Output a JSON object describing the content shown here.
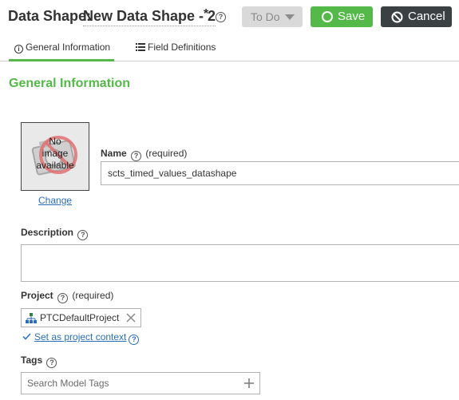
{
  "header": {
    "title_prefix": "Data Shape:",
    "title_name": "New Data Shape - 2",
    "unsaved_marker": "*",
    "help": "?",
    "state_label": "To Do",
    "save_label": "Save",
    "cancel_label": "Cancel"
  },
  "tabs": [
    {
      "label": "General Information",
      "icon": "info-icon",
      "active": true
    },
    {
      "label": "Field Definitions",
      "icon": "list-icon",
      "active": false
    }
  ],
  "section": {
    "title": "General Information"
  },
  "image": {
    "placeholder_text": "No image available",
    "line1": "No",
    "line2": "image",
    "line3": "available",
    "change_label": "Change"
  },
  "form": {
    "name_label": "Name",
    "name_required": "(required)",
    "name_value": "scts_timed_values_datashape",
    "description_label": "Description",
    "description_value": "",
    "project_label": "Project",
    "project_required": "(required)",
    "project_value": "PTCDefaultProject",
    "set_context_label": "Set as project context",
    "tags_label": "Tags",
    "tags_placeholder": "Search Model Tags"
  },
  "colors": {
    "accent_green": "#54b948",
    "dark_button": "#3b4043",
    "link_blue": "#2a6ebb",
    "disabled_gray": "#d9d9d9"
  }
}
